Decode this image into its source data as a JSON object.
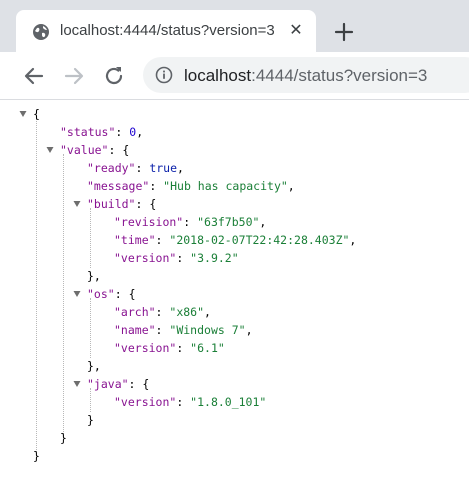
{
  "tab": {
    "title": "localhost:4444/status?version=3",
    "favicon": "globe-icon",
    "close_glyph": "✕"
  },
  "toolbar": {
    "url_host": "localhost",
    "url_path": ":4444/status?version=3"
  },
  "json_lines": [
    {
      "text": "{"
    },
    {
      "key": "\"status\"",
      "value": "0",
      "value_type": "number",
      "suffix": ","
    },
    {
      "key": "\"value\"",
      "open": "{"
    },
    {
      "key": "\"ready\"",
      "value": "true",
      "value_type": "bool",
      "suffix": ","
    },
    {
      "key": "\"message\"",
      "value": "\"Hub has capacity\"",
      "value_type": "string",
      "suffix": ","
    },
    {
      "key": "\"build\"",
      "open": "{"
    },
    {
      "key": "\"revision\"",
      "value": "\"63f7b50\"",
      "value_type": "string",
      "suffix": ","
    },
    {
      "key": "\"time\"",
      "value": "\"2018-02-07T22:42:28.403Z\"",
      "value_type": "string",
      "suffix": ","
    },
    {
      "key": "\"version\"",
      "value": "\"3.9.2\"",
      "value_type": "string",
      "suffix": ""
    },
    {
      "text": "},"
    },
    {
      "key": "\"os\"",
      "open": "{"
    },
    {
      "key": "\"arch\"",
      "value": "\"x86\"",
      "value_type": "string",
      "suffix": ","
    },
    {
      "key": "\"name\"",
      "value": "\"Windows 7\"",
      "value_type": "string",
      "suffix": ","
    },
    {
      "key": "\"version\"",
      "value": "\"6.1\"",
      "value_type": "string",
      "suffix": ""
    },
    {
      "text": "},"
    },
    {
      "key": "\"java\"",
      "open": "{"
    },
    {
      "key": "\"version\"",
      "value": "\"1.8.0_101\"",
      "value_type": "string",
      "suffix": ""
    },
    {
      "text": "}"
    },
    {
      "text": "}"
    },
    {
      "text": "}"
    }
  ],
  "colors": {
    "key": "#881391",
    "string": "#1a7f37",
    "number": "#1c00cf",
    "bool": "#0d22aa",
    "tab_strip": "#dee1e6",
    "omnibox": "#f1f3f4"
  }
}
